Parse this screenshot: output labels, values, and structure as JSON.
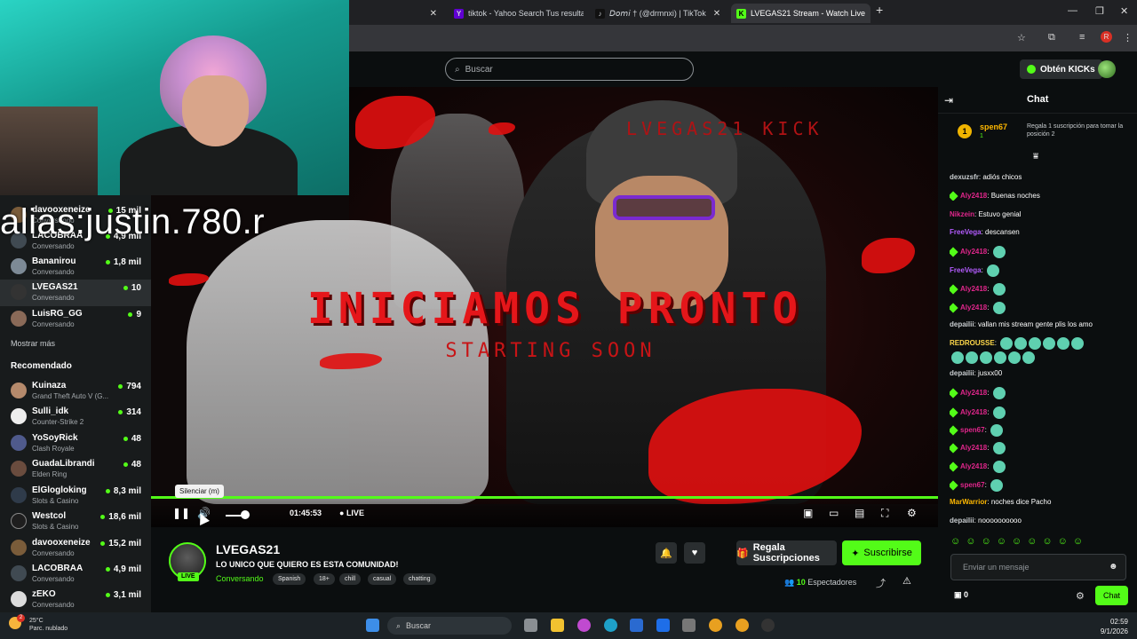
{
  "browser": {
    "tabs": [
      {
        "label": "",
        "active": false
      },
      {
        "label": "tiktok - Yahoo Search Tus resulta",
        "active": false
      },
      {
        "label": "𝘋𝘰𝘮𝘪 † (@drmnxi) | TikTok",
        "active": false
      },
      {
        "label": "LVEGAS21 Stream - Watch Live",
        "active": true
      }
    ],
    "new_tab": "+",
    "close": "✕"
  },
  "header": {
    "search_placeholder": "Buscar",
    "get_kicks": "Obtén KICKs"
  },
  "webcam": {
    "watermark": "alias:justin.780.r"
  },
  "sidebar": {
    "following": [
      {
        "name": "davooxeneize",
        "sub": "Conversando",
        "viewers": "15 mil"
      },
      {
        "name": "LACOBRAA",
        "sub": "Conversando",
        "viewers": "4,9 mil"
      },
      {
        "name": "Bananirou",
        "sub": "Conversando",
        "viewers": "1,8 mil"
      },
      {
        "name": "LVEGAS21",
        "sub": "Conversando",
        "viewers": "10"
      },
      {
        "name": "LuisRG_GG",
        "sub": "Conversando",
        "viewers": "9"
      }
    ],
    "show_more": "Mostrar más",
    "recommended_title": "Recomendado",
    "recommended": [
      {
        "name": "Kuinaza",
        "sub": "Grand Theft Auto V (G...",
        "viewers": "794"
      },
      {
        "name": "Sulli_idk",
        "sub": "Counter-Strike 2",
        "viewers": "314"
      },
      {
        "name": "YoSoyRick",
        "sub": "Clash Royale",
        "viewers": "48"
      },
      {
        "name": "GuadaLibrandi",
        "sub": "Elden Ring",
        "viewers": "48"
      },
      {
        "name": "ElGlogloking",
        "sub": "Slots & Casino",
        "viewers": "8,3 mil"
      },
      {
        "name": "Westcol",
        "sub": "Slots & Casino",
        "viewers": "18,6 mil"
      },
      {
        "name": "davooxeneize",
        "sub": "Conversando",
        "viewers": "15,2 mil"
      },
      {
        "name": "LACOBRAA",
        "sub": "Conversando",
        "viewers": "4,9 mil"
      },
      {
        "name": "zEKO",
        "sub": "Conversando",
        "viewers": "3,1 mil"
      }
    ]
  },
  "video": {
    "overlay_title": "INICIAMOS PRONTO",
    "overlay_subtitle": "STARTING SOON",
    "overlay_brand": "LVEGAS21 KICK",
    "tooltip": "Silenciar (m)",
    "time": "01:45:53",
    "live_label": "LIVE"
  },
  "stream": {
    "channel": "LVEGAS21",
    "title": "LO UNICO QUE QUIERO ES ESTA COMUNIDAD!",
    "category": "Conversando",
    "tags": [
      "Spanish",
      "18+",
      "chill",
      "casual",
      "chatting"
    ],
    "live_badge": "LIVE",
    "gift_label": "Regala Suscripciones",
    "subscribe_label": "Suscribirse",
    "viewers_count": "10",
    "viewers_label": "Espectadores"
  },
  "chat": {
    "title": "Chat",
    "pinned": {
      "user": "spen67",
      "count": "1",
      "coin": "1",
      "message": "Regala 1 suscripción para tomar la posición 2"
    },
    "messages": [
      {
        "user": "dexuzsfr",
        "color": "#c9cdd0",
        "text": "adiós chicos",
        "badge": false,
        "emote": false
      },
      {
        "user": "Aly2418",
        "color": "#e0268b",
        "text": "Buenas noches",
        "badge": true,
        "emote": false
      },
      {
        "user": "Nikzein",
        "color": "#e0268b",
        "text": "Estuvo genial",
        "badge": false,
        "emote": false
      },
      {
        "user": "FreeVega",
        "color": "#b45cff",
        "text": "descansen",
        "badge": false,
        "emote": false
      },
      {
        "user": "Aly2418",
        "color": "#e0268b",
        "text": "",
        "badge": true,
        "emote": true
      },
      {
        "user": "FreeVega",
        "color": "#b45cff",
        "text": "",
        "badge": false,
        "emote": true
      },
      {
        "user": "Aly2418",
        "color": "#e0268b",
        "text": "",
        "badge": true,
        "emote": true
      },
      {
        "user": "Aly2418",
        "color": "#e0268b",
        "text": "",
        "badge": true,
        "emote": true
      },
      {
        "user": "depailii",
        "color": "#c9cdd0",
        "text": "vallan mis stream gente plis los amo",
        "badge": false,
        "emote": false
      },
      {
        "user": "REDROUSSE",
        "color": "#ffd84a",
        "text": "",
        "badge": false,
        "emote": true
      },
      {
        "user": "",
        "color": "#c9cdd0",
        "text": "",
        "badge": false,
        "emote": true
      },
      {
        "user": "depailii",
        "color": "#c9cdd0",
        "text": "jusxx00",
        "badge": false,
        "emote": false
      },
      {
        "user": "Aly2418",
        "color": "#e0268b",
        "text": "",
        "badge": true,
        "emote": true
      },
      {
        "user": "Aly2418",
        "color": "#e0268b",
        "text": "",
        "badge": true,
        "emote": true
      },
      {
        "user": "spen67",
        "color": "#e0268b",
        "text": "",
        "badge": true,
        "emote": true
      },
      {
        "user": "Aly2418",
        "color": "#e0268b",
        "text": "",
        "badge": true,
        "emote": true
      },
      {
        "user": "Aly2418",
        "color": "#e0268b",
        "text": "",
        "badge": true,
        "emote": true
      },
      {
        "user": "spen67",
        "color": "#e0268b",
        "text": "",
        "badge": true,
        "emote": true
      },
      {
        "user": "MarWarrior",
        "color": "#ffb800",
        "text": "noches dice Pacho",
        "badge": false,
        "emote": false
      },
      {
        "user": "depailii",
        "color": "#c9cdd0",
        "text": "noooooooooo",
        "badge": false,
        "emote": false
      }
    ],
    "input_placeholder": "Enviar un mensaje",
    "points": "0",
    "send_label": "Chat"
  },
  "taskbar": {
    "weather_temp": "25°C",
    "weather_desc": "Parc. nublado",
    "weather_alert": "2",
    "search": "Buscar",
    "time": "02:59",
    "date": "9/1/2026"
  },
  "colors": {
    "accent": "#53fc18",
    "background": "#0b0e0f",
    "sidebar": "#181b1c"
  }
}
